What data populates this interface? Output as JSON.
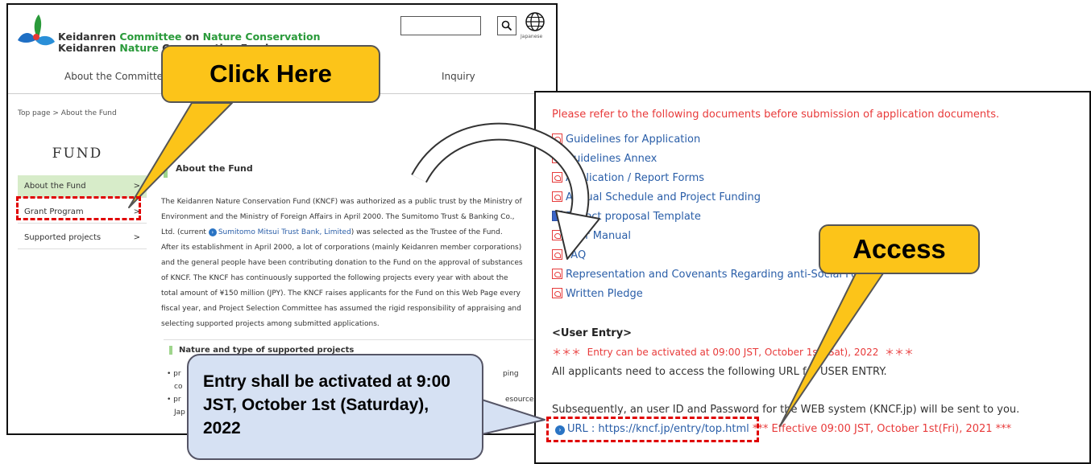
{
  "left": {
    "org_line1_parts": [
      "Keidanren ",
      "Committee",
      " on ",
      "Nature",
      " ",
      "Conservation"
    ],
    "org_line2_parts": [
      "Keidanren ",
      "Nature",
      " Cons"
    ],
    "org_line2_tail": "ervation Fund",
    "lang_label": "Japanese",
    "nav": [
      "About the Committee",
      "Inquiry"
    ],
    "breadcrumb": "Top page  >  About the Fund",
    "side_title": "FUND",
    "side_items": [
      {
        "label": "About the Fund",
        "chevron": ">"
      },
      {
        "label": "Grant Program",
        "chevron": ">"
      },
      {
        "label": "Supported projects",
        "chevron": ">"
      }
    ],
    "heading": "About the Fund",
    "body_lines": [
      "The Keidanren Nature Conservation Fund (KNCF) was authorized as a public trust by the Ministry of",
      "Environment and the Ministry of Foreign Affairs in April 2000. The Sumitomo Trust & Banking Co.,",
      "Ltd. (current ",
      ") was selected as the Trustee of the Fund.",
      "After its establishment in April 2000, a lot of corporations (mainly Keidanren member corporations)",
      "and the general people have been contributing donation to the Fund on the approval of substances",
      "of KNCF. The KNCF has continuously supported the following projects every year with about the",
      "total amount of ¥150 million (JPY). The KNCF raises applicants for the Fund on this Web Page every",
      "fiscal year, and Project Selection Committee has assumed the rigid responsibility of appraising and",
      "selecting supported projects among submitted applications."
    ],
    "body_link": "Sumitomo Mitsui Trust Bank, Limited",
    "section_heading": "Nature and type of supported projects",
    "bullets": [
      {
        "marker": "• pr",
        "tail": "ping",
        "cont": "co"
      },
      {
        "marker": "• pr",
        "tail": "esources in",
        "cont": "Jap"
      }
    ]
  },
  "right": {
    "instruction": "Please refer to the following documents before submission of application documents.",
    "documents": [
      {
        "label": "Guidelines for Application",
        "icon": "pdf-icon"
      },
      {
        "label": "Guidelines Annex",
        "icon": "pdf-icon"
      },
      {
        "label": "Application / Report Forms",
        "icon": "pdf-icon"
      },
      {
        "label": "Annual Schedule and Project Funding",
        "icon": "pdf-icon"
      },
      {
        "label": "Project proposal Template",
        "icon": "doc-icon"
      },
      {
        "label": "User Manual",
        "icon": "pdf-icon"
      },
      {
        "label": "FAQ",
        "icon": "pdf-icon"
      },
      {
        "label": "Representation and Covenants Regarding anti-Social Forces",
        "icon": "pdf-icon"
      },
      {
        "label": "Written Pledge",
        "icon": "pdf-icon"
      }
    ],
    "user_entry_heading": "<User Entry>",
    "entry_note": "＊＊＊  Entry can be activated at 09:00 JST, October 1st (Sat), 2022  ＊＊＊",
    "access_note": "All applicants need to access the following URL for USER ENTRY.",
    "subsequent_note": "Subsequently, an user ID and Password for the WEB system (KNCF.jp) will be sent to you.",
    "url_text": "URL : https://kncf.jp/entry/top.html",
    "url_effective": "*** Effective 09:00 JST, October 1st(Fri), 2021 ***"
  },
  "callouts": {
    "click_here": "Click Here",
    "access": "Access",
    "entry_activated": "Entry shall be activated at 9:00 JST, October 1st (Saturday), 2022"
  },
  "colors": {
    "callout_yellow": "#fcc419",
    "callout_blue": "#d6e1f3",
    "dashed_highlight": "#e00000",
    "link_blue": "#2a5ea8",
    "notice_red": "#e83a3a",
    "active_green": "#d7ecc9"
  }
}
